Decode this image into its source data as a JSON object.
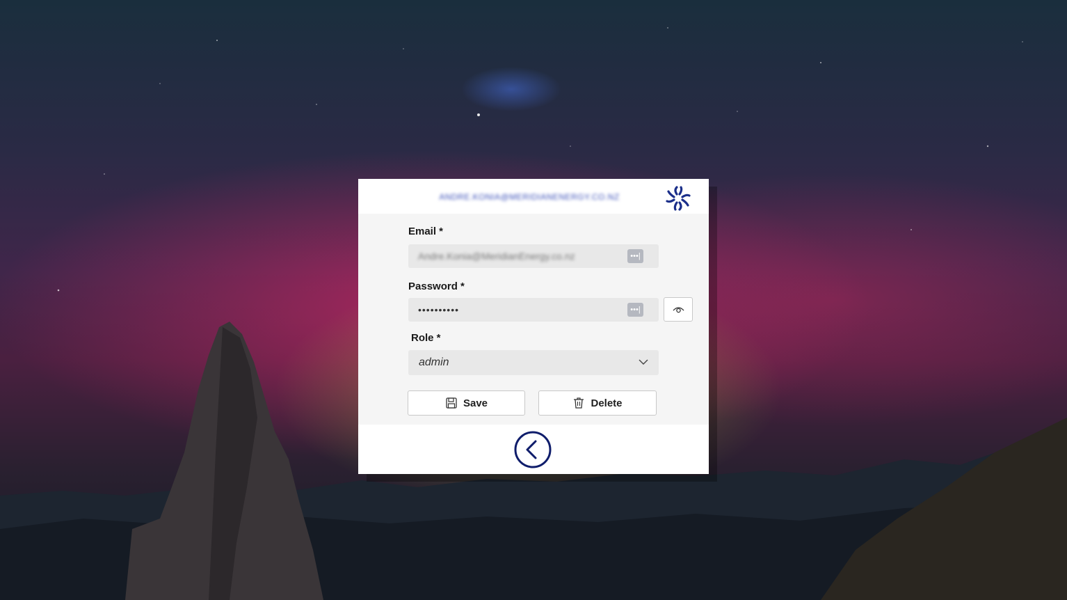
{
  "header": {
    "user_label": "ANDRE.KONIA@MERIDIANENERGY.CO.NZ",
    "logo_icon": "spinner-logo-icon",
    "brand_color": "#1b2f8a"
  },
  "form": {
    "email_label": "Email *",
    "email_value": "Andre.Konia@MeridianEnergy.co.nz",
    "password_label": "Password *",
    "password_value": "••••••••••",
    "autofill_badge": "•••|",
    "role_label": "Role *",
    "role_value": "admin"
  },
  "actions": {
    "save_label": "Save",
    "delete_label": "Delete"
  },
  "footer": {
    "back_icon": "back-arrow-icon"
  }
}
